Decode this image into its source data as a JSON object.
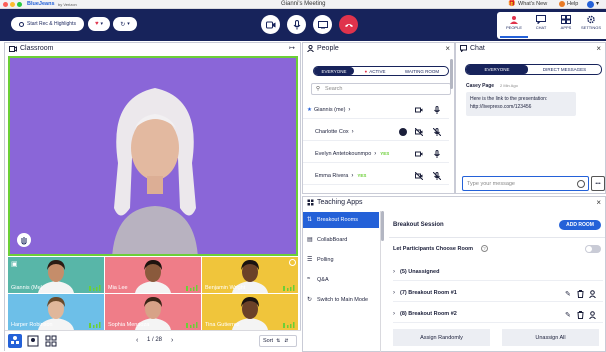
{
  "window": {
    "title": "Gianni's Meeting",
    "brand": "BlueJeans",
    "brand_suffix": "by Verizon",
    "whats_new": "What's New",
    "help": "Help"
  },
  "toolbar": {
    "record_label": "Start Rec & Highlights",
    "nav": [
      {
        "label": "PEOPLE",
        "icon": "people-icon"
      },
      {
        "label": "CHAT",
        "icon": "chat-icon"
      },
      {
        "label": "APPS",
        "icon": "apps-icon"
      },
      {
        "label": "SETTINGS",
        "icon": "gear-icon"
      }
    ]
  },
  "classroom": {
    "title": "Classroom"
  },
  "tiles": [
    {
      "name": "Giannis (Me)",
      "bg": "#58b6a8"
    },
    {
      "name": "Mia Lee",
      "bg": "#ef7d88"
    },
    {
      "name": "Benjamin Wright",
      "bg": "#f0c53b"
    },
    {
      "name": "Harper Robinson",
      "bg": "#6dbfe8"
    },
    {
      "name": "Sophia Mendoza",
      "bg": "#ef7d88"
    },
    {
      "name": "Tina Gutierrez",
      "bg": "#f0c53b"
    }
  ],
  "gallery": {
    "page": "1 / 28",
    "sort_label": "Sort"
  },
  "people": {
    "title": "People",
    "tabs": {
      "everyone": "EVERYONE",
      "active": "ACTIVE",
      "waiting": "WAITING ROOM"
    },
    "search_placeholder": "Search",
    "rows": [
      {
        "name": "Giannis (me)",
        "badge": ""
      },
      {
        "name": "Charlotte Cox",
        "badge": ""
      },
      {
        "name": "Evelyn Antetokounmpo",
        "badge": "YES"
      },
      {
        "name": "Emma Rivera",
        "badge": "YES"
      }
    ]
  },
  "chat": {
    "title": "Chat",
    "tabs": {
      "everyone": "EVERYONE",
      "direct": "DIRECT MESSAGES"
    },
    "sender": "Casey Page",
    "time": "2 Min Ago",
    "message": "Here is the link to the presentation: http://livepreso.com/123456",
    "input_placeholder": "Type your message",
    "more": "•••"
  },
  "apps": {
    "title": "Teaching Apps",
    "menu": [
      {
        "label": "Breakout Rooms",
        "icon": "breakout-icon"
      },
      {
        "label": "CollabBoard",
        "icon": "board-icon"
      },
      {
        "label": "Polling",
        "icon": "polling-icon"
      },
      {
        "label": "Q&A",
        "icon": "qa-icon"
      },
      {
        "label": "Switch to Main Mode",
        "icon": "switch-icon"
      }
    ],
    "breakout": {
      "title": "Breakout Session",
      "add_room": "ADD ROOM",
      "choose_label": "Let Participants Choose Room",
      "rooms": [
        {
          "label": "(5) Unassigned"
        },
        {
          "label": "(7) Breakout Room #1"
        },
        {
          "label": "(8) Breakout Room #2"
        }
      ],
      "assign_random": "Assign Randomly",
      "unassign_all": "Unassign All"
    }
  },
  "colors": {
    "navy": "#17235b",
    "accent": "#2461d8",
    "highlight_green": "#6ccf37",
    "end_red": "#e0334c"
  }
}
